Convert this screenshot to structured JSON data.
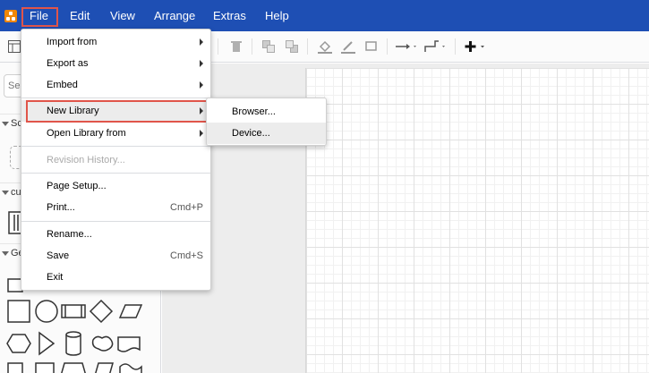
{
  "menubar": {
    "items": [
      "File",
      "Edit",
      "View",
      "Arrange",
      "Extras",
      "Help"
    ]
  },
  "sidebar": {
    "search_placeholder": "Se",
    "sections": [
      "Sc",
      "cu",
      "Ge"
    ]
  },
  "file_menu": {
    "items": [
      {
        "label": "Import from",
        "submenu": true,
        "enabled": true
      },
      {
        "label": "Export as",
        "submenu": true,
        "enabled": true
      },
      {
        "label": "Embed",
        "submenu": true,
        "enabled": true
      },
      {
        "label": "New Library",
        "submenu": true,
        "enabled": true,
        "highlighted": true
      },
      {
        "label": "Open Library from",
        "submenu": true,
        "enabled": true
      },
      {
        "label": "Revision History...",
        "submenu": false,
        "enabled": false
      },
      {
        "label": "Page Setup...",
        "submenu": false,
        "enabled": true
      },
      {
        "label": "Print...",
        "shortcut": "Cmd+P",
        "enabled": true
      },
      {
        "label": "Rename...",
        "submenu": false,
        "enabled": true
      },
      {
        "label": "Save",
        "shortcut": "Cmd+S",
        "enabled": true
      },
      {
        "label": "Exit",
        "submenu": false,
        "enabled": true
      }
    ]
  },
  "library_submenu": {
    "items": [
      {
        "label": "Browser...",
        "hovered": false
      },
      {
        "label": "Device...",
        "hovered": true
      }
    ]
  },
  "colors": {
    "menubar_bg": "#1e4fb4",
    "logo": "#f08705",
    "highlight_outline": "#e0554a",
    "disabled_text": "#aaaaaa",
    "hover_bg": "#ececec"
  }
}
